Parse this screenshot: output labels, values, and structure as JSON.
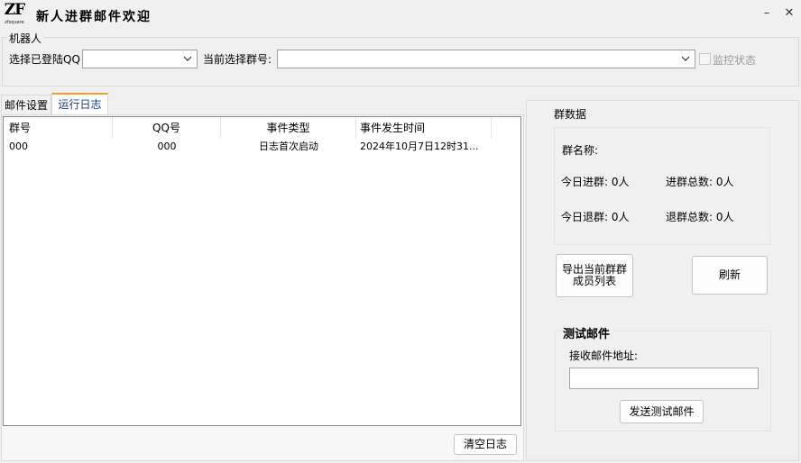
{
  "window": {
    "title": "新人进群邮件欢迎",
    "logo_main": "ZF",
    "logo_sub": "zfsquare",
    "minimize": "–",
    "close": "✕"
  },
  "robot": {
    "group_label": "机器人",
    "qq_label": "选择已登陆QQ",
    "qq_value": "",
    "group_label2": "当前选择群号:",
    "group_value": "",
    "monitor_label": "监控状态",
    "monitor_checked": false
  },
  "tabs": [
    {
      "label": "邮件设置",
      "active": false
    },
    {
      "label": "运行日志",
      "active": true
    }
  ],
  "log": {
    "columns": [
      "群号",
      "QQ号",
      "事件类型",
      "事件发生时间"
    ],
    "rows": [
      [
        "000",
        "000",
        "日志首次启动",
        "2024年10月7日12时31..."
      ]
    ],
    "clear_button": "清空日志"
  },
  "group_data": {
    "title": "群数据",
    "name_label": "群名称:",
    "today_join": "今日进群: 0人",
    "total_join": "进群总数: 0人",
    "today_leave": "今日退群: 0人",
    "total_leave": "退群总数: 0人",
    "export_button": "导出当前群群\n成员列表",
    "refresh_button": "刷新"
  },
  "test_mail": {
    "title": "测试邮件",
    "address_label": "接收邮件地址:",
    "address_value": "",
    "send_button": "发送测试邮件"
  }
}
